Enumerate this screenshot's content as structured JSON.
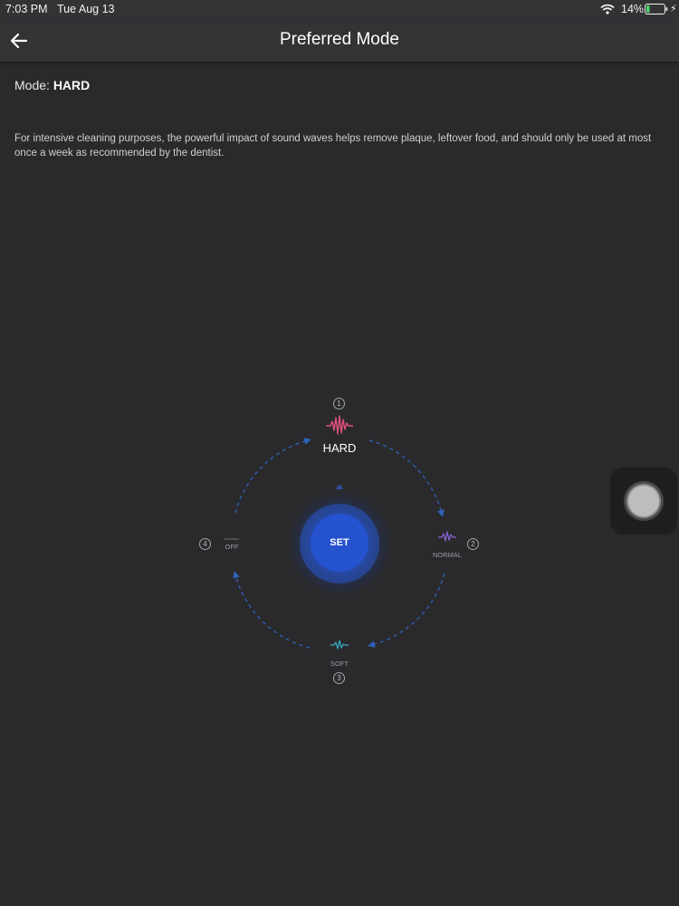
{
  "status_bar": {
    "time": "7:03 PM",
    "date": "Tue Aug 13",
    "battery_pct": "14%"
  },
  "header": {
    "title": "Preferred Mode"
  },
  "mode": {
    "label": "Mode:",
    "value": "HARD"
  },
  "description": "For intensive cleaning purposes, the powerful impact of sound waves helps remove plaque, leftover food, and should only be used at most once a week as recommended by the dentist.",
  "dial": {
    "set_label": "SET",
    "selected_label": "HARD",
    "options": [
      {
        "number": "1",
        "label": "HARD",
        "color": "#e0507a"
      },
      {
        "number": "2",
        "label": "NORMAL",
        "color": "#8a64d6"
      },
      {
        "number": "3",
        "label": "SOFT",
        "color": "#3bb0c4"
      },
      {
        "number": "4",
        "label": "OFF",
        "color": "#6e6e72"
      }
    ]
  },
  "colors": {
    "background": "#2a2a2d",
    "bar": "#333336",
    "accent": "#2552cf",
    "dashes": "#2f62b8"
  }
}
